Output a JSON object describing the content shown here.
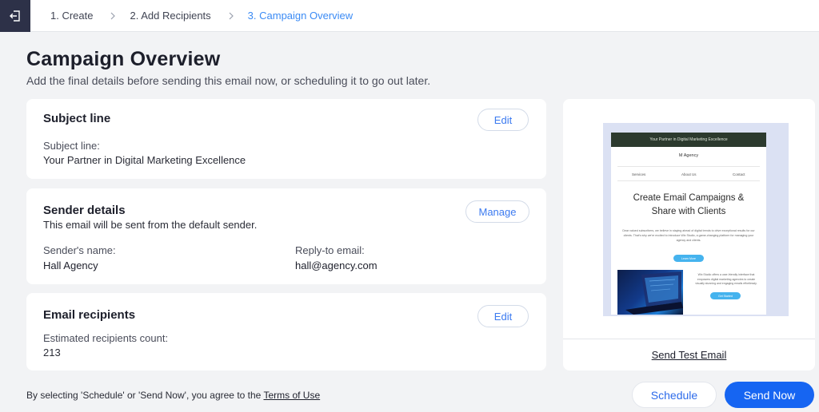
{
  "stepper": {
    "steps": [
      {
        "label": "1. Create",
        "active": false
      },
      {
        "label": "2. Add Recipients",
        "active": false
      },
      {
        "label": "3. Campaign Overview",
        "active": true
      }
    ]
  },
  "header": {
    "title": "Campaign Overview",
    "subtitle": "Add the final details before sending this email now, or scheduling it to go out later."
  },
  "subject_card": {
    "title": "Subject line",
    "edit_label": "Edit",
    "field_label": "Subject line:",
    "field_value": "Your Partner in Digital Marketing Excellence"
  },
  "sender_card": {
    "title": "Sender details",
    "description": "This email will be sent from the default sender.",
    "manage_label": "Manage",
    "name_label": "Sender's name:",
    "name_value": "Hall Agency",
    "reply_label": "Reply-to email:",
    "reply_value": "hall@agency.com"
  },
  "recipients_card": {
    "title": "Email recipients",
    "edit_label": "Edit",
    "count_label": "Estimated recipients count:",
    "count_value": "213"
  },
  "preview": {
    "email": {
      "header_text": "Your Partner in Digital Marketing Excellence",
      "brand": "M Agency",
      "nav": [
        "Services",
        "About Us",
        "Contact"
      ],
      "hero_line1": "Create Email Campaigns &",
      "hero_line2": "Share with Clients",
      "paragraph": "Dear valued subscribers, we believe in staying ahead of digital trends to drive exceptional results for our clients. That's why we're excited to introduce Wix Studio, a game-changing platform for managing your agency and clients.",
      "cta1": "Learn More",
      "side_text": "Wix Studio offers a user-friendly interface that empowers digital marketing agencies to create visually stunning and engaging emails effortlessly.",
      "cta2": "Get Started"
    },
    "send_test_label": "Send Test Email"
  },
  "footer": {
    "agreement_text": "By selecting 'Schedule' or 'Send Now', you agree to the ",
    "terms_label": "Terms of Use",
    "schedule_label": "Schedule",
    "send_now_label": "Send Now"
  },
  "colors": {
    "accent": "#1665f2",
    "active_step": "#3b8bf5",
    "exit_button_bg": "#2d3148",
    "page_bg": "#f2f3f5"
  }
}
